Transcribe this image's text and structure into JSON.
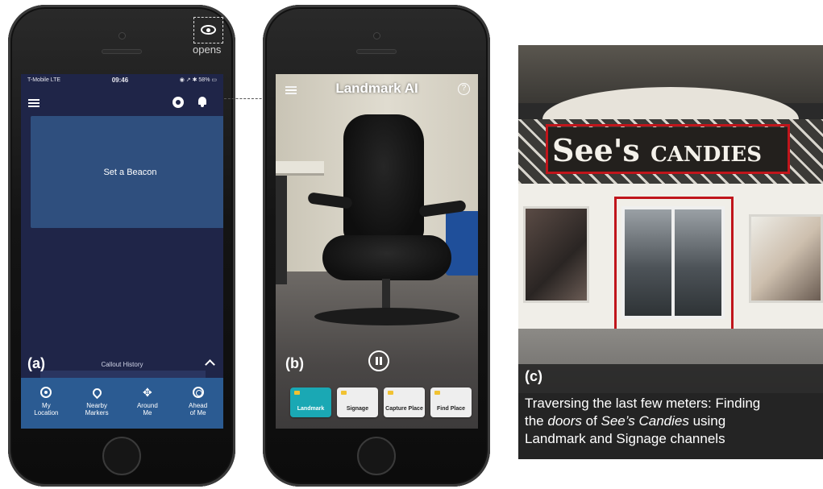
{
  "panel_a": {
    "label": "(a)",
    "status": {
      "carrier": "T-Mobile  LTE",
      "time": "09:46",
      "battery": "◉ ↗ ✱ 58% ▭"
    },
    "icons": {
      "menu": "hamburger-icon",
      "location": "map-pin-icon",
      "notifications": "bell-icon",
      "landmark_ai": "eye-icon"
    },
    "annotation": "opens",
    "beacon_card": "Set a Beacon",
    "callout_history": "Callout History",
    "nav": [
      {
        "icon": "target-icon",
        "line1": "My",
        "line2": "Location"
      },
      {
        "icon": "map-pin-icon",
        "line1": "Nearby",
        "line2": "Markers"
      },
      {
        "icon": "compass-arrows-icon",
        "line1": "Around",
        "line2": "Me"
      },
      {
        "icon": "radar-icon",
        "line1": "Ahead",
        "line2": "of Me"
      }
    ],
    "colors": {
      "background": "#1f2548",
      "card": "#2f4f7e",
      "nav": "#2b5b92"
    }
  },
  "panel_b": {
    "label": "(b)",
    "title": "Landmark AI",
    "help": "?",
    "channels": [
      "Landmark",
      "Signage",
      "Capture Place",
      "Find Place"
    ],
    "active_channel": "Landmark",
    "colors": {
      "active_channel": "#1aa8b4"
    }
  },
  "panel_c": {
    "label": "(c)",
    "sign": {
      "main": "See's",
      "sub": "CANDIES"
    },
    "caption_1": "Traversing the last few meters: Finding",
    "caption_2a": "the ",
    "caption_2b": "doors",
    "caption_2c": " of ",
    "caption_2d": "See’s Candies",
    "caption_2e": " using",
    "caption_3": "Landmark and Signage channels",
    "colors": {
      "highlight_box": "#c0151b"
    }
  }
}
